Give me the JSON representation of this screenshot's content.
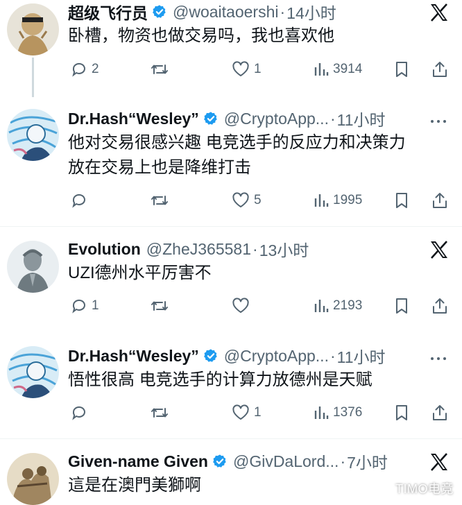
{
  "tweets": [
    {
      "name": "超级飞行员",
      "handle": "@woaitaoershi",
      "time": "14小时",
      "text": [
        "卧槽，物资也做交易吗，我也喜欢他"
      ],
      "replies": "2",
      "retweets": "",
      "likes": "1",
      "views": "3914",
      "corner": "x-logo"
    },
    {
      "name": "Dr.Hash“Wesley”",
      "handle": "@CryptoApp...",
      "time": "11小时",
      "text": [
        "他对交易很感兴趣 电竞选手的反应力和决策力",
        "放在交易上也是降维打击"
      ],
      "replies": "",
      "retweets": "",
      "likes": "5",
      "views": "1995",
      "corner": "more"
    },
    {
      "name": "Evolution",
      "handle": "@ZheJ365581",
      "time": "13小时",
      "text": [
        "UZI德州水平厉害不"
      ],
      "replies": "1",
      "retweets": "",
      "likes": "",
      "views": "2193",
      "corner": "x-logo"
    },
    {
      "name": "Dr.Hash“Wesley”",
      "handle": "@CryptoApp...",
      "time": "11小时",
      "text": [
        "悟性很高 电竞选手的计算力放德州是天赋"
      ],
      "replies": "",
      "retweets": "",
      "likes": "1",
      "views": "1376",
      "corner": "more"
    },
    {
      "name": "Given-name Given",
      "handle": "@GivDaLord...",
      "time": "7小时",
      "text": [
        "這是在澳門美獅啊"
      ],
      "corner": "x-logo"
    }
  ],
  "separator": "·",
  "watermark": "TIMO电竞",
  "colors": {
    "accent": "#1d9bf0",
    "secondary_text": "#536471",
    "thread_line": "#cfd9de"
  }
}
